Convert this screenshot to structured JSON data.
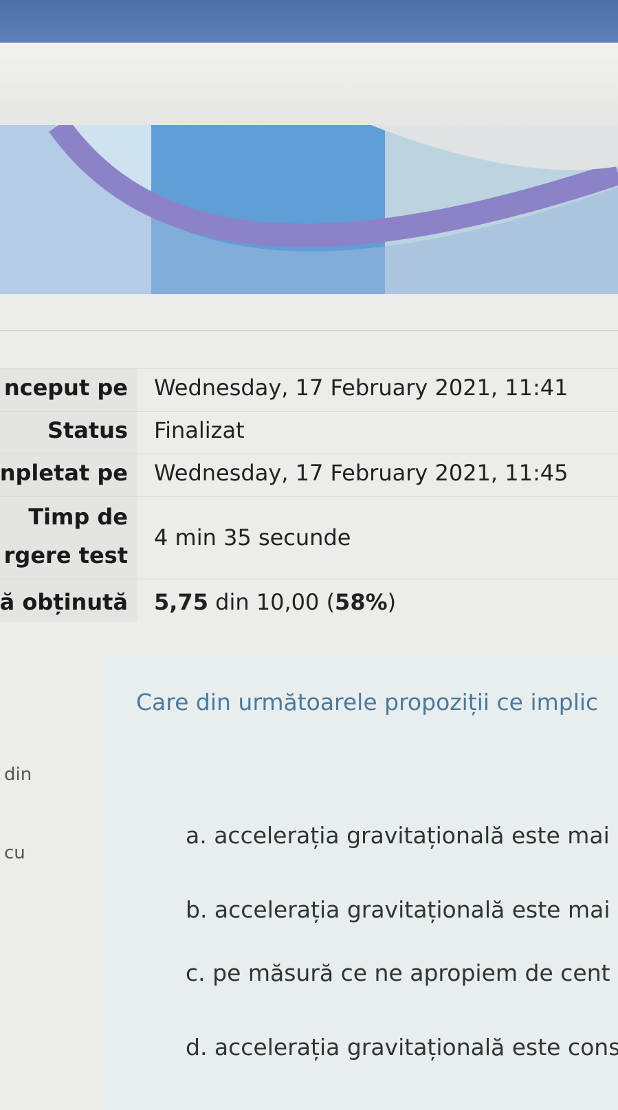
{
  "summary": {
    "rows": [
      {
        "label": "nceput pe",
        "value": "Wednesday, 17 February 2021, 11:41"
      },
      {
        "label": "Status",
        "value": "Finalizat"
      },
      {
        "label": "npletat pe",
        "value": "Wednesday, 17 February 2021, 11:45"
      },
      {
        "label_line1": "Timp de",
        "label_line2": "rgere test",
        "value": "4 min 35 secunde"
      },
      {
        "label": "ă obținută",
        "score": "5,75",
        "middle": " din 10,00 (",
        "percent": "58%",
        "end": ")"
      }
    ]
  },
  "question": {
    "text": "Care din următoarele propoziții ce implic",
    "side_labels": [
      "din",
      "cu"
    ],
    "answers": [
      "a. accelerația gravitațională este mai",
      "b. accelerația gravitațională este mai",
      "c. pe măsură ce ne apropiem de cent",
      "d. accelerația gravitațională este cons"
    ]
  }
}
